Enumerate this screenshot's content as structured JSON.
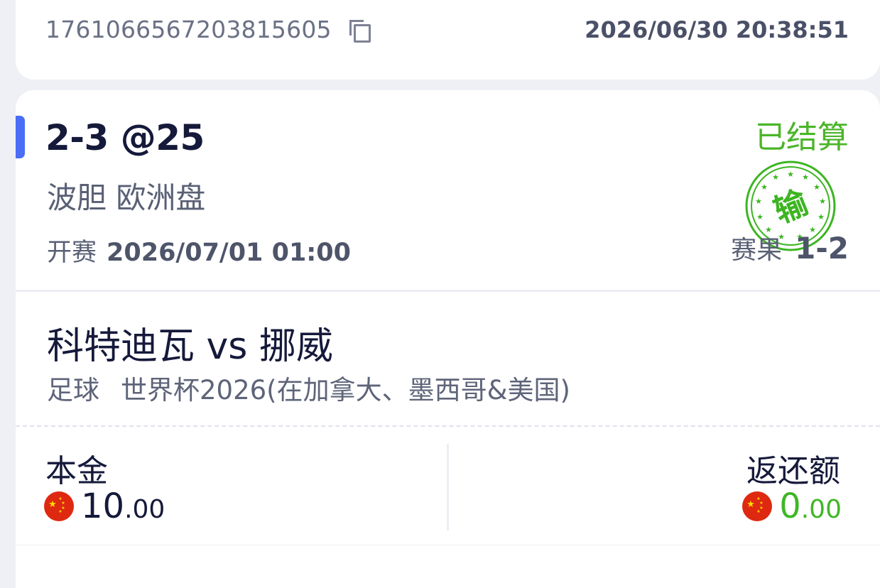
{
  "previous_order": {
    "order_id": "1761066567203815605",
    "order_time": "2026/06/30 20:38:51"
  },
  "bet": {
    "pick": "2-3 @25",
    "status": "已结算",
    "bet_type": "波胆 欧洲盘",
    "kickoff_label": "开赛",
    "kickoff_time": "2026/07/01 01:00",
    "result_label": "赛果",
    "result_score": "1-2",
    "stamp_text": "输",
    "stamp_color": "#3cb521"
  },
  "match": {
    "teams": "科特迪瓦 vs 挪威",
    "sport": "足球",
    "league": "世界杯2026(在加拿大、墨西哥&美国)"
  },
  "amounts": {
    "stake_label": "本金",
    "stake_int": "10",
    "stake_dec": ".00",
    "return_label": "返还额",
    "return_int": "0",
    "return_dec": ".00",
    "currency_icon": "china-flag-icon",
    "return_color": "#3fb726"
  },
  "colors": {
    "accent": "#4a6cf7",
    "settled_green": "#4bb52a"
  }
}
